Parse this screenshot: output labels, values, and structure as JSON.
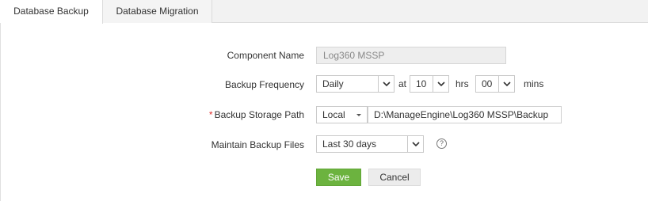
{
  "tabs": [
    {
      "label": "Database Backup",
      "active": true
    },
    {
      "label": "Database Migration",
      "active": false
    }
  ],
  "form": {
    "component_name": {
      "label": "Component Name",
      "value": "Log360 MSSP"
    },
    "backup_frequency": {
      "label": "Backup Frequency",
      "frequency": "Daily",
      "at_text": "at",
      "hours": "10",
      "hrs_text": "hrs",
      "minutes": "00",
      "mins_text": "mins"
    },
    "storage_path": {
      "required_mark": "*",
      "label": "Backup Storage Path",
      "location": "Local",
      "path": "D:\\ManageEngine\\Log360 MSSP\\Backup"
    },
    "maintain_files": {
      "label": "Maintain Backup Files",
      "value": "Last 30 days",
      "help_symbol": "?"
    }
  },
  "buttons": {
    "save": "Save",
    "cancel": "Cancel"
  },
  "colors": {
    "save_button": "#6cb33f",
    "required_mark": "#e0302e"
  },
  "icons": [
    "chevron-down-icon",
    "caret-down-icon",
    "help-icon"
  ]
}
